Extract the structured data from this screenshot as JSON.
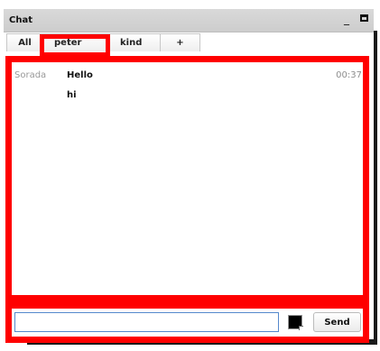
{
  "window": {
    "title": "Chat",
    "minimize_symbol": "_",
    "maximize_icon": "maximize-icon"
  },
  "tabs": [
    {
      "label": "All",
      "selected": false
    },
    {
      "label": "peter",
      "selected": true
    },
    {
      "label": "kind",
      "selected": false
    },
    {
      "label": "+",
      "selected": false
    }
  ],
  "messages": [
    {
      "sender": "Sorada",
      "text": "Hello",
      "time": "00:37"
    },
    {
      "sender": "",
      "text": "hi",
      "time": ""
    }
  ],
  "composer": {
    "input_value": "",
    "input_placeholder": "",
    "color_value": "#000000",
    "send_label": "Send"
  },
  "colors": {
    "highlight": "#ff0000",
    "title_bar": "#d4d4d4",
    "input_border": "#5588cc"
  }
}
